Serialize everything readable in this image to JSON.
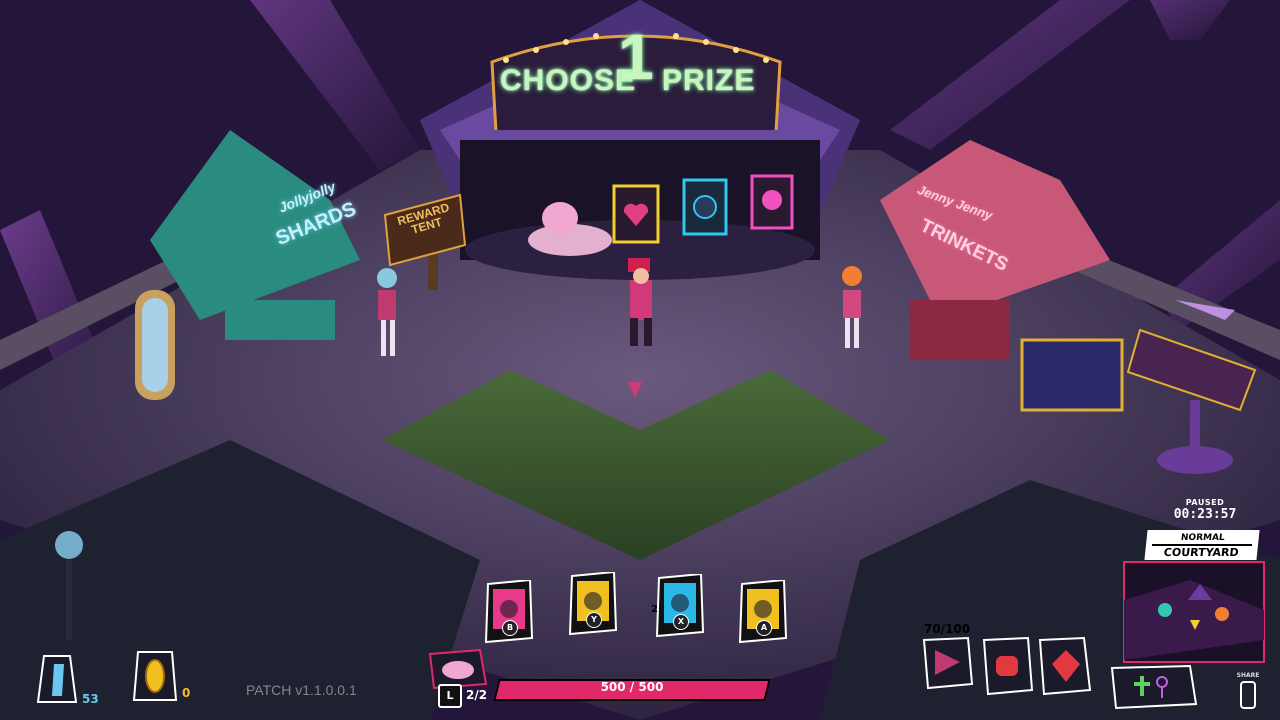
{
  "sign": {
    "choose": "CHOOSE",
    "number": "1",
    "prize": "PRIZE"
  },
  "booths": {
    "left_script": "Jollyjolly",
    "left_title": "SHARDS",
    "right_script": "Jenny Jenny",
    "right_title": "TRINKETS",
    "reward_sign_line1": "REWARD",
    "reward_sign_line2": "TENT"
  },
  "hud": {
    "paused_label": "PAUSED",
    "timer": "00:23:57",
    "difficulty": "NORMAL",
    "area": "COURTYARD",
    "shards_count": "53",
    "coins_count": "0",
    "patch": "PATCH v1.1.0.0.1",
    "hp_text": "500 / 500",
    "hp_fraction": 1.0,
    "potion_key": "L",
    "potion_count": "2/2",
    "charge": "70/100",
    "share_label": "SHARE",
    "card_multiplier": "2"
  },
  "skills": [
    {
      "button": "B",
      "color": "#e83a8a"
    },
    {
      "button": "Y",
      "color": "#f0c020"
    },
    {
      "button": "X",
      "color": "#2ab8e8"
    },
    {
      "button": "A",
      "color": "#f0c020"
    }
  ],
  "colors": {
    "accent_pink": "#e0286a",
    "neon_green": "#c8f5c0",
    "tent_purple": "#5a3c8c",
    "left_tent": "#2c8c84",
    "right_tent": "#d0607c"
  }
}
